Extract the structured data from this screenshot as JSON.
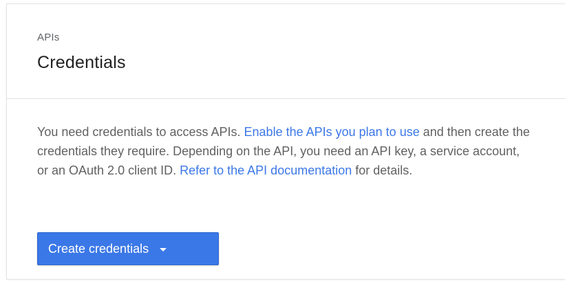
{
  "header": {
    "eyebrow": "APIs",
    "title": "Credentials"
  },
  "body": {
    "desc_part1": "You need credentials to access APIs. ",
    "link_enable": "Enable the APIs you plan to use",
    "desc_part2": " and then create the credentials they require. Depending on the API, you need an API key, a service account, or an OAuth 2.0 client ID. ",
    "link_docs": "Refer to the API documentation",
    "desc_part3": " for details."
  },
  "actions": {
    "create_label": "Create credentials",
    "caret_icon": "caret-down-icon"
  },
  "colors": {
    "accent": "#3b78e7",
    "text": "#616161",
    "title": "#212121"
  }
}
